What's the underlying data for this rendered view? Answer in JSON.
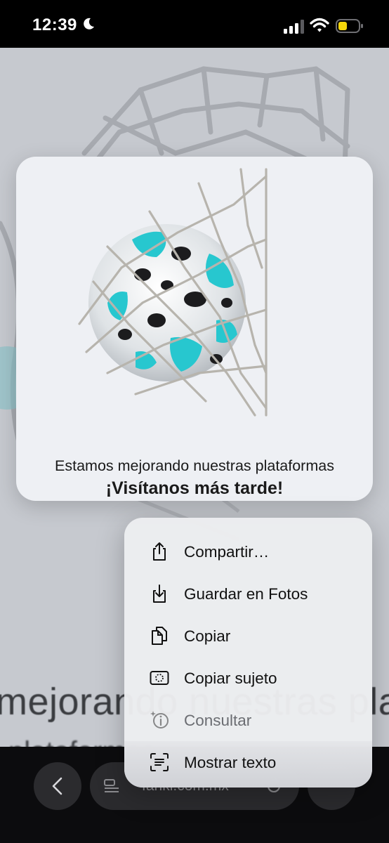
{
  "status_bar": {
    "time": "12:39",
    "icons": [
      "moon-icon",
      "signal-icon",
      "wifi-icon",
      "battery-icon"
    ],
    "battery_color": "#f5d60a"
  },
  "preview": {
    "line1": "Estamos mejorando nuestras plataformas",
    "line2": "¡Visítanos más tarde!",
    "image": "soccer-ball-in-net"
  },
  "background_page": {
    "text1": "mejorando nuestras pla",
    "text2": "plataformas"
  },
  "context_menu": {
    "items": [
      {
        "label": "Compartir…",
        "icon": "share-icon",
        "enabled": true
      },
      {
        "label": "Guardar en Fotos",
        "icon": "save-to-photos-icon",
        "enabled": true
      },
      {
        "label": "Copiar",
        "icon": "copy-icon",
        "enabled": true
      },
      {
        "label": "Copiar sujeto",
        "icon": "copy-subject-icon",
        "enabled": true
      },
      {
        "label": "Consultar",
        "icon": "look-up-icon",
        "enabled": false
      },
      {
        "label": "Mostrar texto",
        "icon": "show-text-icon",
        "enabled": true
      }
    ]
  },
  "browser_bar": {
    "address": "fanki.com.mx",
    "icons": [
      "back-icon",
      "page-menu-icon",
      "reload-icon"
    ]
  }
}
